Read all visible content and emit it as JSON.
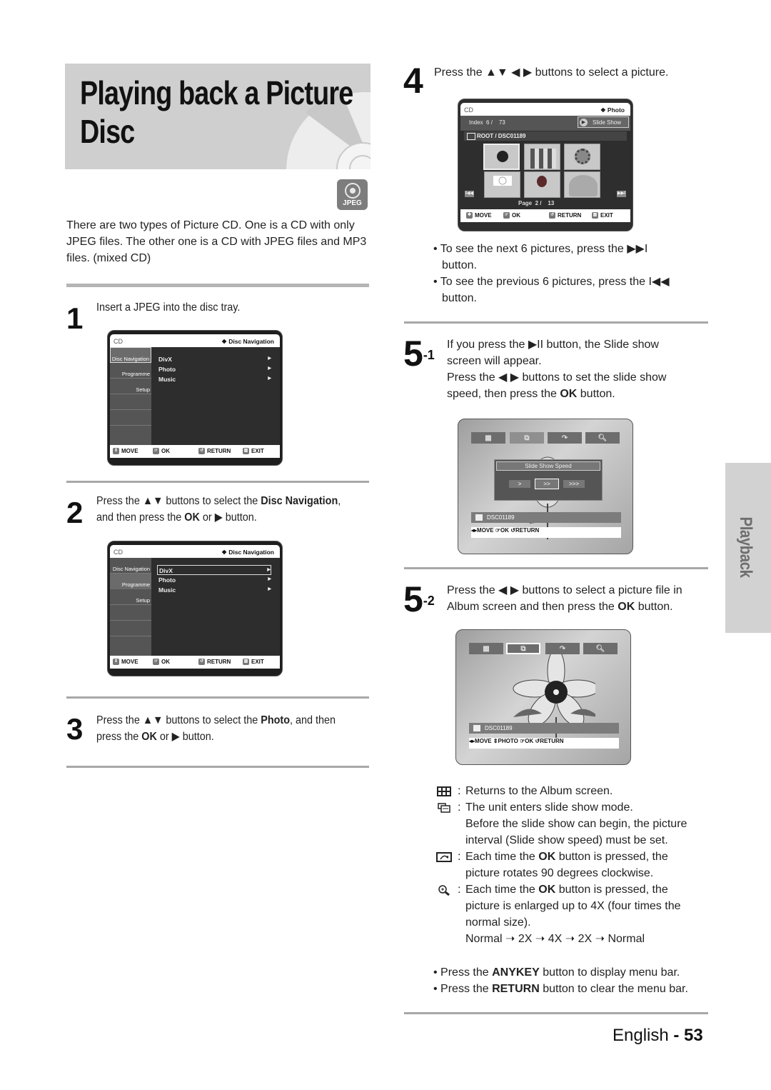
{
  "header": {
    "title_line1": "Playing back a Picture",
    "title_line2": "Disc",
    "badge_label": "JPEG"
  },
  "intro": "There are two types of Picture CD. One is a CD with only JPEG files. The other one is a CD with JPEG files and MP3 files. (mixed CD)",
  "steps": {
    "s1": {
      "num": "1",
      "text": "Insert a JPEG into the disc tray."
    },
    "s2": {
      "num": "2",
      "t1": "Press the ▲▼ buttons to select the ",
      "b1": "Disc Navigation",
      "t2": ",",
      "t3": "and then press the ",
      "b2": "OK",
      "t4": " or ▶ button."
    },
    "s3": {
      "num": "3",
      "t1": "Press the ▲▼ buttons to select the ",
      "b1": "Photo",
      "t2": ", and then",
      "t3": "press the ",
      "b2": "OK",
      "t4": " or ▶ button."
    },
    "s4": {
      "num": "4",
      "text": "Press the ▲▼ ◀ ▶ buttons to select a picture."
    },
    "s4_bullets": [
      {
        "l1": "• To see the next 6 pictures, press the ▶▶I",
        "l2": "button."
      },
      {
        "l1": "• To see the previous 6 pictures, press the I◀◀",
        "l2": "button."
      }
    ],
    "s51": {
      "num": "5",
      "sup": "-1",
      "l1": "If you press the ▶II button, the Slide show",
      "l2": "screen will appear.",
      "l3": "Press the ◀ ▶ buttons to set the slide show",
      "l4a": "speed, then press the ",
      "l4b": "OK",
      "l4c": " button."
    },
    "s52": {
      "num": "5",
      "sup": "-2",
      "l1": "Press the ◀ ▶ buttons to select a picture file in",
      "l2a": "Album screen and then press the ",
      "l2b": "OK",
      "l2c": " button."
    }
  },
  "disc_nav_screen": {
    "source": "CD",
    "title": "❖ Disc Navigation",
    "side": [
      "Disc Navigation",
      "Programme",
      "Setup"
    ],
    "items": [
      "DivX",
      "Photo",
      "Music"
    ],
    "footer": {
      "move": "MOVE",
      "ok": "OK",
      "return": "RETURN",
      "exit": "EXIT"
    }
  },
  "photo_screen": {
    "source": "CD",
    "title": "❖ Photo",
    "index_label": "Index",
    "index_value": "6 /",
    "index_total": "73",
    "slide_show": "Slide Show",
    "path": "ROOT / DSC01189",
    "page_label": "Page",
    "page_value": "2 /",
    "page_total": "13",
    "footer": {
      "move": "MOVE",
      "ok": "OK",
      "return": "RETURN",
      "exit": "EXIT"
    }
  },
  "slide_speed_screen": {
    "dialog_title": "Slide Show Speed",
    "speeds": [
      ">",
      ">>",
      ">>>"
    ],
    "selected_speed": 2,
    "filename": "DSC01189",
    "footer": {
      "move": "MOVE",
      "ok": "OK",
      "return": "RETURN"
    }
  },
  "album_screen": {
    "filename": "DSC01189",
    "footer": {
      "move": "MOVE",
      "photo": "PHOTO",
      "ok": "OK",
      "return": "RETURN"
    }
  },
  "legend": [
    {
      "icon": "album-grid-icon",
      "text": "Returns to the Album screen."
    },
    {
      "icon": "slideshow-icon",
      "text": "The unit enters slide show mode.",
      "extra1": "Before the slide show can begin, the picture",
      "extra2": "interval (Slide show speed) must be set."
    },
    {
      "icon": "rotate-icon",
      "t1": "Each time the ",
      "b": "OK",
      "t2": " button is pressed, the",
      "extra1": "picture rotates 90 degrees clockwise."
    },
    {
      "icon": "zoom-icon",
      "t1": "Each time the ",
      "b": "OK",
      "t2": " button is pressed, the",
      "extra1": "picture is enlarged up to 4X (four times the",
      "extra2": "normal size).",
      "extra3": "Normal ➝ 2X ➝ 4X ➝ 2X ➝ Normal"
    }
  ],
  "tips": [
    {
      "t1": "• Press the ",
      "b": "ANYKEY",
      "t2": " button to display menu bar."
    },
    {
      "t1": "• Press the ",
      "b": "RETURN",
      "t2": " button to clear the menu bar."
    }
  ],
  "side_tab": "Playback",
  "footer": {
    "lang": "English",
    "sep": " - ",
    "page": "53"
  }
}
